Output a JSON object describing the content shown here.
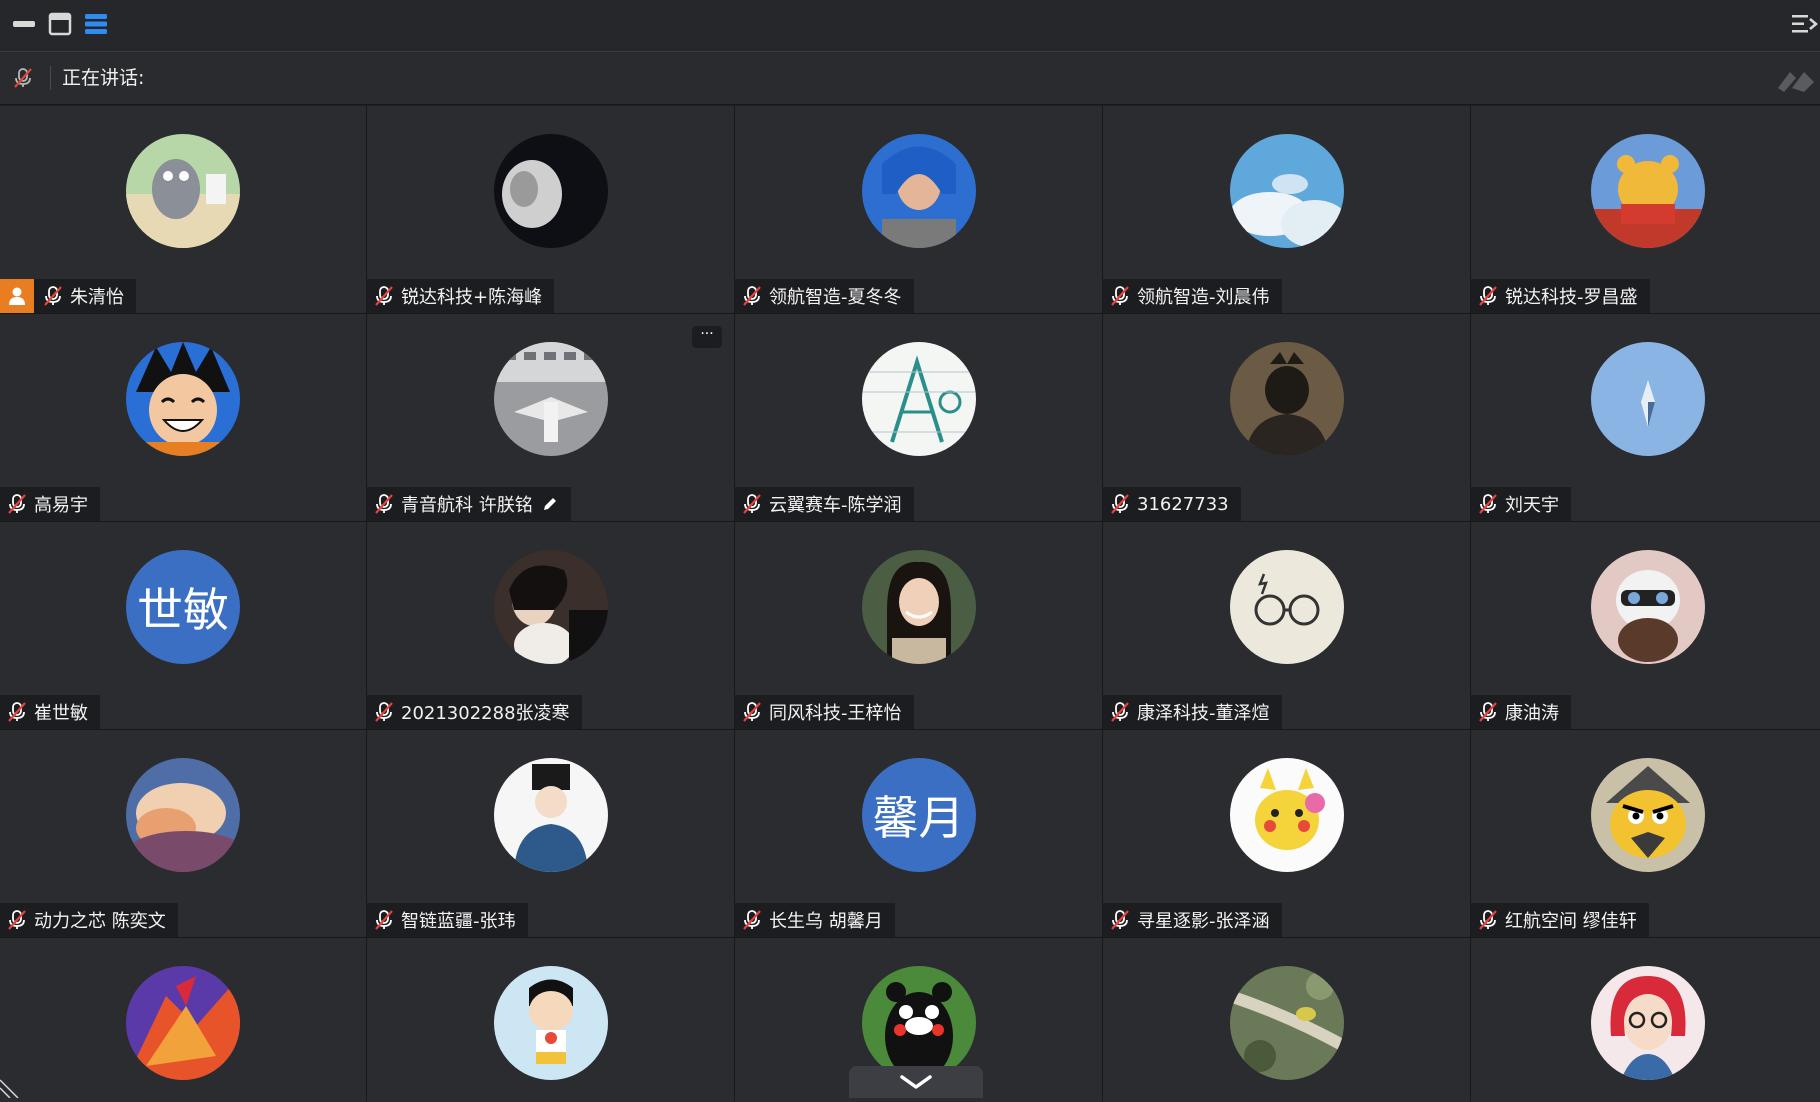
{
  "window_controls": {
    "minimize": "minimize-icon",
    "window": "window-icon",
    "layout": "list-layout-icon",
    "right_panel": "panel-collapse-icon"
  },
  "speaking": {
    "label": "正在讲话:",
    "speaker": ""
  },
  "participants": [
    {
      "name": "朱清怡",
      "host": true,
      "avatar": "cartoon-fish"
    },
    {
      "name": "锐达科技+陈海峰",
      "avatar": "white-cat-dark"
    },
    {
      "name": "领航智造-夏冬冬",
      "avatar": "man-blue-hoodie"
    },
    {
      "name": "领航智造-刘晨伟",
      "avatar": "blue-sky"
    },
    {
      "name": "锐达科技-罗昌盛",
      "avatar": "winnie-the-pooh"
    },
    {
      "name": "高易宇",
      "avatar": "goku-smile"
    },
    {
      "name": "青音航科 许朕铭",
      "avatar": "aircraft-hangar",
      "self": true,
      "more": "···"
    },
    {
      "name": "云翼赛车-陈学润",
      "avatar": "sketch-drawing"
    },
    {
      "name": "31627733",
      "avatar": "dark-figure"
    },
    {
      "name": "刘天宇",
      "avatar": "light-blue-icon"
    },
    {
      "name": "崔世敏",
      "avatar_text": "世敏"
    },
    {
      "name": "2021302288张凌寒",
      "avatar": "girl-dark"
    },
    {
      "name": "同风科技-王梓怡",
      "avatar": "girl-smiling"
    },
    {
      "name": "康泽科技-董泽煊",
      "avatar": "glasses-icon"
    },
    {
      "name": "康油涛",
      "avatar": "pilot-cartoon"
    },
    {
      "name": "动力之芯 陈奕文",
      "avatar": "cloud-sunset"
    },
    {
      "name": "智链蓝疆-张玮",
      "avatar": "illustrated-man"
    },
    {
      "name": "长生乌 胡馨月",
      "avatar_text": "馨月"
    },
    {
      "name": "寻星逐影-张泽涵",
      "avatar": "pikachu"
    },
    {
      "name": "红航空间 缪佳轩",
      "avatar": "angry-bird-warrior"
    },
    {
      "name": "",
      "avatar": "fiery-art"
    },
    {
      "name": "",
      "avatar": "crayon-shin-chan"
    },
    {
      "name": "",
      "avatar": "kumamon"
    },
    {
      "name": "",
      "avatar": "bird-on-branch"
    },
    {
      "name": "",
      "avatar": "red-hair-girl"
    }
  ],
  "colors": {
    "tile_bg": "#2b2c30",
    "host_badge": "#e87d22",
    "text_avatar_bg": "#3a6fc4",
    "muted_red": "#e0453a"
  }
}
